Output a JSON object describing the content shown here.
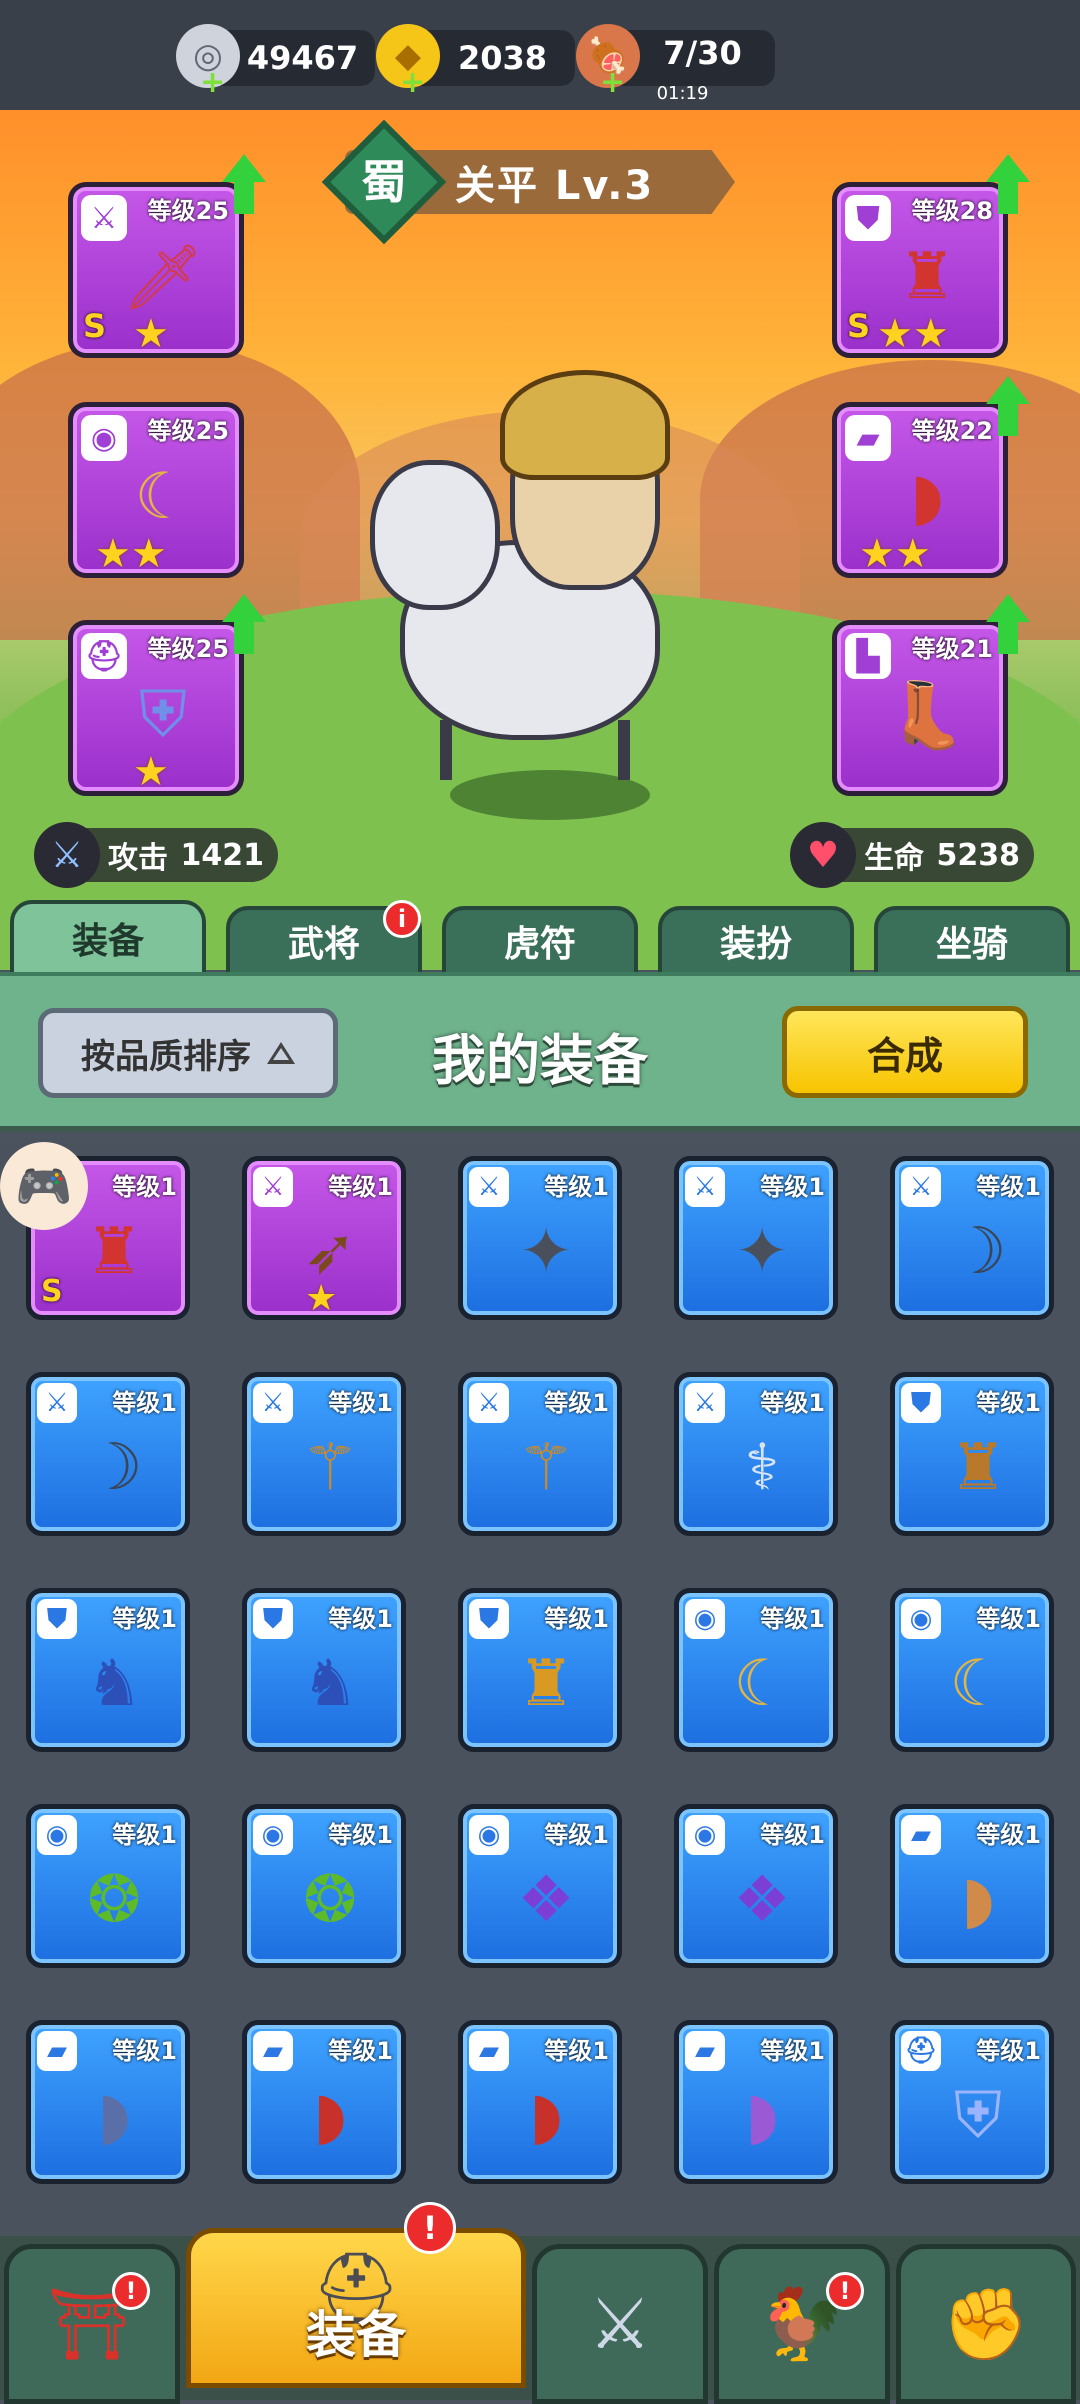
{
  "resources": {
    "coins": "49467",
    "ingots": "2038",
    "stamina": "7/30",
    "stamina_timer": "01:19"
  },
  "hero": {
    "faction": "蜀",
    "name_level": "关平  Lv.3",
    "attack_label": "攻击",
    "attack_value": "1421",
    "hp_label": "生命",
    "hp_value": "5238"
  },
  "equipped": {
    "left": [
      {
        "type_icon": "sword-icon",
        "level": "等级25",
        "grade": "S",
        "stars": "★",
        "upgrade": true
      },
      {
        "type_icon": "medal-icon",
        "level": "等级25",
        "grade": "",
        "stars": "★★",
        "upgrade": false
      },
      {
        "type_icon": "helmet-icon",
        "level": "等级25",
        "grade": "",
        "stars": "★",
        "upgrade": true
      }
    ],
    "right": [
      {
        "type_icon": "armor-icon",
        "level": "等级28",
        "grade": "S",
        "stars": "★★",
        "upgrade": true
      },
      {
        "type_icon": "bracer-icon",
        "level": "等级22",
        "grade": "",
        "stars": "★★",
        "upgrade": true
      },
      {
        "type_icon": "boots-icon",
        "level": "等级21",
        "grade": "",
        "stars": "",
        "upgrade": true
      }
    ]
  },
  "tabs": [
    {
      "label": "装备",
      "active": true
    },
    {
      "label": "武将",
      "badge": "i"
    },
    {
      "label": "虎符"
    },
    {
      "label": "装扮"
    },
    {
      "label": "坐骑"
    }
  ],
  "panel": {
    "sort_label": "按品质排序",
    "title": "我的装备",
    "synthesize_label": "合成"
  },
  "inventory": [
    {
      "rarity": "purple",
      "type": "armor",
      "level": "等级1",
      "grade": "S",
      "stars": ""
    },
    {
      "rarity": "purple",
      "type": "sword",
      "level": "等级1",
      "grade": "",
      "stars": "★"
    },
    {
      "rarity": "blue",
      "type": "sword",
      "level": "等级1"
    },
    {
      "rarity": "blue",
      "type": "sword",
      "level": "等级1"
    },
    {
      "rarity": "blue",
      "type": "sword",
      "level": "等级1"
    },
    {
      "rarity": "blue",
      "type": "sword",
      "level": "等级1"
    },
    {
      "rarity": "blue",
      "type": "sword",
      "level": "等级1"
    },
    {
      "rarity": "blue",
      "type": "sword",
      "level": "等级1"
    },
    {
      "rarity": "blue",
      "type": "sword",
      "level": "等级1"
    },
    {
      "rarity": "blue",
      "type": "armor",
      "level": "等级1"
    },
    {
      "rarity": "blue",
      "type": "armor",
      "level": "等级1"
    },
    {
      "rarity": "blue",
      "type": "armor",
      "level": "等级1"
    },
    {
      "rarity": "blue",
      "type": "armor",
      "level": "等级1"
    },
    {
      "rarity": "blue",
      "type": "medal",
      "level": "等级1"
    },
    {
      "rarity": "blue",
      "type": "medal",
      "level": "等级1"
    },
    {
      "rarity": "blue",
      "type": "medal",
      "level": "等级1"
    },
    {
      "rarity": "blue",
      "type": "medal",
      "level": "等级1"
    },
    {
      "rarity": "blue",
      "type": "medal",
      "level": "等级1"
    },
    {
      "rarity": "blue",
      "type": "medal",
      "level": "等级1"
    },
    {
      "rarity": "blue",
      "type": "bracer",
      "level": "等级1"
    },
    {
      "rarity": "blue",
      "type": "bracer",
      "level": "等级1"
    },
    {
      "rarity": "blue",
      "type": "bracer",
      "level": "等级1"
    },
    {
      "rarity": "blue",
      "type": "bracer",
      "level": "等级1"
    },
    {
      "rarity": "blue",
      "type": "bracer",
      "level": "等级1"
    },
    {
      "rarity": "blue",
      "type": "helmet",
      "level": "等级1"
    }
  ],
  "bottom_nav": [
    {
      "icon": "shop-icon",
      "badge": "!"
    },
    {
      "icon": "equipment-helmet-icon",
      "label": "装备",
      "active": true,
      "badge": "!"
    },
    {
      "icon": "battle-shield-icon"
    },
    {
      "icon": "rooster-icon",
      "badge": "!"
    },
    {
      "icon": "fist-upgrade-icon"
    }
  ],
  "colors": {
    "purple_rarity": "#b548dc",
    "blue_rarity": "#2f8cf2",
    "upgrade_arrow": "#33d13b",
    "badge_red": "#ec2c2c"
  }
}
